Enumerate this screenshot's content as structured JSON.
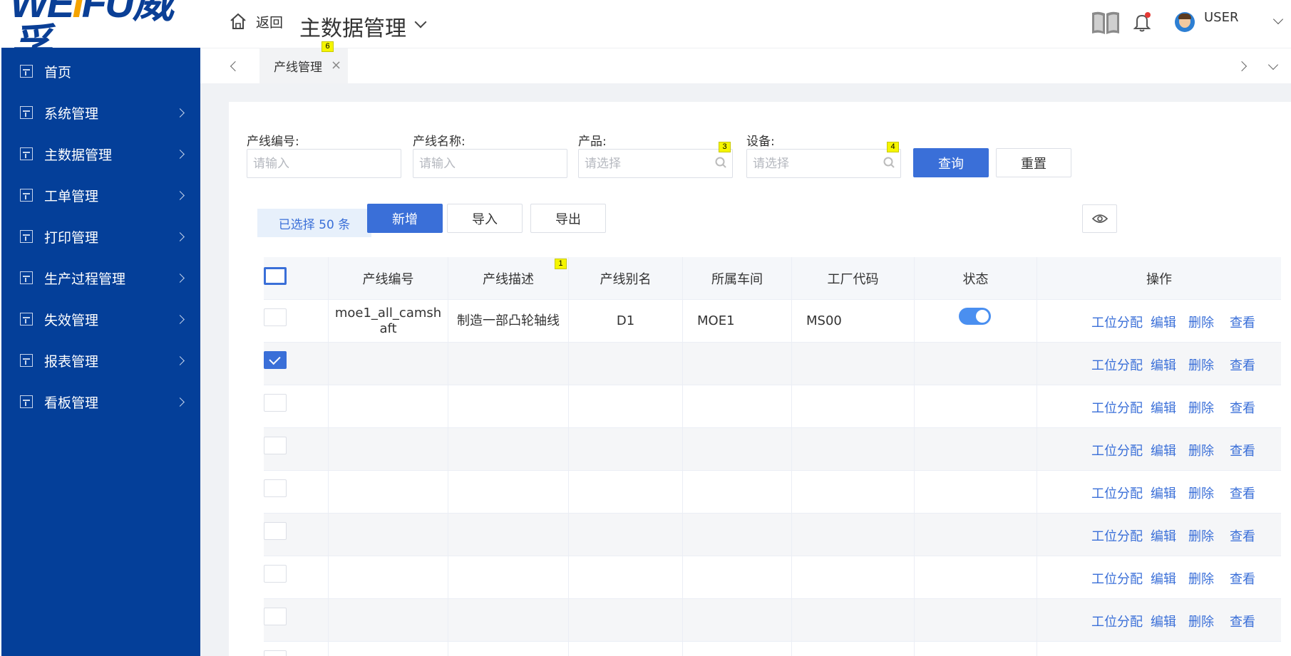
{
  "brand": {
    "logo_left": "WE",
    "logo_bar": "I",
    "logo_right": "FU威孚"
  },
  "sidebar": {
    "items": [
      {
        "label": "首页",
        "has_children": false
      },
      {
        "label": "系统管理",
        "has_children": true
      },
      {
        "label": "主数据管理",
        "has_children": true
      },
      {
        "label": "工单管理",
        "has_children": true
      },
      {
        "label": "打印管理",
        "has_children": true
      },
      {
        "label": "生产过程管理",
        "has_children": true
      },
      {
        "label": "失效管理",
        "has_children": true
      },
      {
        "label": "报表管理",
        "has_children": true
      },
      {
        "label": "看板管理",
        "has_children": true
      }
    ]
  },
  "header": {
    "back_label": "返回",
    "module_title": "主数据管理",
    "user_label": "USER",
    "accent_color": "#3a6fd8",
    "sidebar_color": "#043f99"
  },
  "tabs": [
    {
      "label": "产线管理",
      "badge": "6"
    }
  ],
  "filters": {
    "line_code": {
      "label": "产线编号:",
      "placeholder": "请输入"
    },
    "line_name": {
      "label": "产线名称:",
      "placeholder": "请输入"
    },
    "product": {
      "label": "产品:",
      "placeholder": "请选择",
      "badge": "3"
    },
    "device": {
      "label": "设备:",
      "placeholder": "请选择",
      "badge": "4"
    },
    "query_button": "查询",
    "reset_button": "重置"
  },
  "toolbar": {
    "selected_text": "已选择 50 条",
    "add_button": "新增",
    "import_button": "导入",
    "export_button": "导出"
  },
  "table": {
    "columns": [
      "产线编号",
      "产线描述",
      "产线别名",
      "所属车间",
      "工厂代码",
      "状态",
      "操作"
    ],
    "column_badge": "1",
    "rows": [
      {
        "checked": false,
        "code": "moe1_all_camsh aft",
        "desc": "制造一部凸轮轴线",
        "alias": "D1",
        "workshop": "MOE1",
        "factory": "MS00",
        "status_on": true
      },
      {
        "checked": true,
        "code": "",
        "desc": "",
        "alias": "",
        "workshop": "",
        "factory": "",
        "status_on": false
      },
      {
        "checked": false,
        "code": "",
        "desc": "",
        "alias": "",
        "workshop": "",
        "factory": "",
        "status_on": false
      },
      {
        "checked": false,
        "code": "",
        "desc": "",
        "alias": "",
        "workshop": "",
        "factory": "",
        "status_on": false
      },
      {
        "checked": false,
        "code": "",
        "desc": "",
        "alias": "",
        "workshop": "",
        "factory": "",
        "status_on": false
      },
      {
        "checked": false,
        "code": "",
        "desc": "",
        "alias": "",
        "workshop": "",
        "factory": "",
        "status_on": false
      },
      {
        "checked": false,
        "code": "",
        "desc": "",
        "alias": "",
        "workshop": "",
        "factory": "",
        "status_on": false
      },
      {
        "checked": false,
        "code": "",
        "desc": "",
        "alias": "",
        "workshop": "",
        "factory": "",
        "status_on": false
      },
      {
        "checked": false,
        "code": "",
        "desc": "",
        "alias": "",
        "workshop": "",
        "factory": "",
        "status_on": false
      }
    ],
    "actions": [
      "工位分配",
      "编辑",
      "删除",
      "查看"
    ]
  }
}
